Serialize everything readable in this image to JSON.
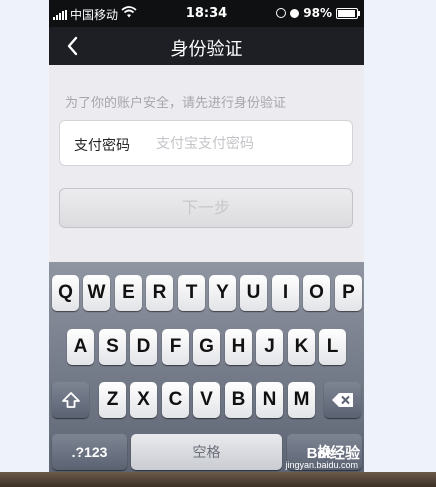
{
  "status_bar": {
    "carrier": "中国移动",
    "time": "18:34",
    "battery": "98%"
  },
  "nav": {
    "title": "身份验证"
  },
  "hint": "为了你的账户安全，请先进行身份验证",
  "password_field": {
    "label": "支付密码",
    "placeholder": "支付宝支付密码",
    "value": ""
  },
  "next_button": "下一步",
  "keyboard": {
    "row1": [
      "Q",
      "W",
      "E",
      "R",
      "T",
      "Y",
      "U",
      "I",
      "O",
      "P"
    ],
    "row2": [
      "A",
      "S",
      "D",
      "F",
      "G",
      "H",
      "J",
      "K",
      "L"
    ],
    "row3": [
      "Z",
      "X",
      "C",
      "V",
      "B",
      "N",
      "M"
    ],
    "numbers_key": ".?123",
    "space_key": "空格",
    "return_key": "换"
  },
  "watermark": {
    "logo": "Bai经验",
    "url": "jingyan.baidu.com"
  },
  "icons": {
    "back": "chevron-left-icon",
    "shift": "shift-icon",
    "delete": "backspace-icon",
    "wifi": "wifi-icon",
    "signal": "signal-bars-icon",
    "battery": "battery-icon"
  }
}
